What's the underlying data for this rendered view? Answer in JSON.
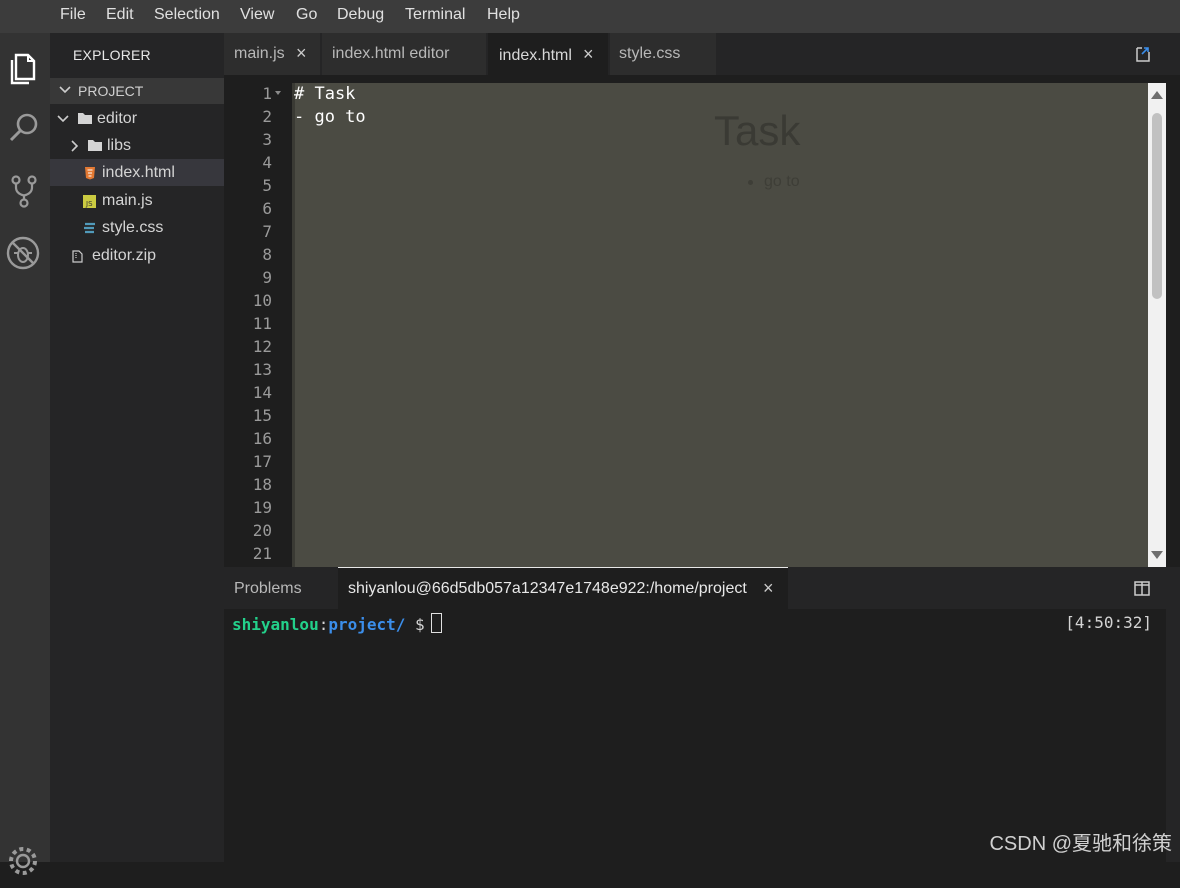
{
  "menu": [
    "File",
    "Edit",
    "Selection",
    "View",
    "Go",
    "Debug",
    "Terminal",
    "Help"
  ],
  "activity_bar": [
    "files-icon",
    "search-icon",
    "source-control-icon",
    "debug-icon",
    "settings-gear-icon"
  ],
  "sidebar": {
    "title": "EXPLORER",
    "project_label": "PROJECT",
    "tree": {
      "editor": "editor",
      "libs": "libs",
      "index_html": "index.html",
      "main_js": "main.js",
      "style_css": "style.css",
      "editor_zip": "editor.zip"
    }
  },
  "tabs": {
    "main_js": "main.js",
    "index_editor": "index.html editor",
    "index_html": "index.html",
    "style_css": "style.css",
    "close": "×"
  },
  "editor": {
    "line_numbers": [
      "1",
      "2",
      "3",
      "4",
      "5",
      "6",
      "7",
      "8",
      "9",
      "10",
      "11",
      "12",
      "13",
      "14",
      "15",
      "16",
      "17",
      "18",
      "19",
      "20",
      "21"
    ],
    "code_lines": [
      "# Task",
      "- go to"
    ],
    "preview_title": "Task",
    "preview_item": "go to"
  },
  "panel": {
    "problems_label": "Problems",
    "terminal_tab_label": "shiyanlou@66d5db057a12347e1748e922:/home/project",
    "close": "×",
    "terminal": {
      "user": "shiyanlou",
      "sep": ":",
      "path": "project/",
      "prompt": "$",
      "time": "[4:50:32]"
    }
  },
  "watermark": "CSDN @夏驰和徐策",
  "colors": {
    "accent_green": "#23d18b",
    "accent_blue": "#3b8eea",
    "editor_bg": "#4b4b43"
  }
}
